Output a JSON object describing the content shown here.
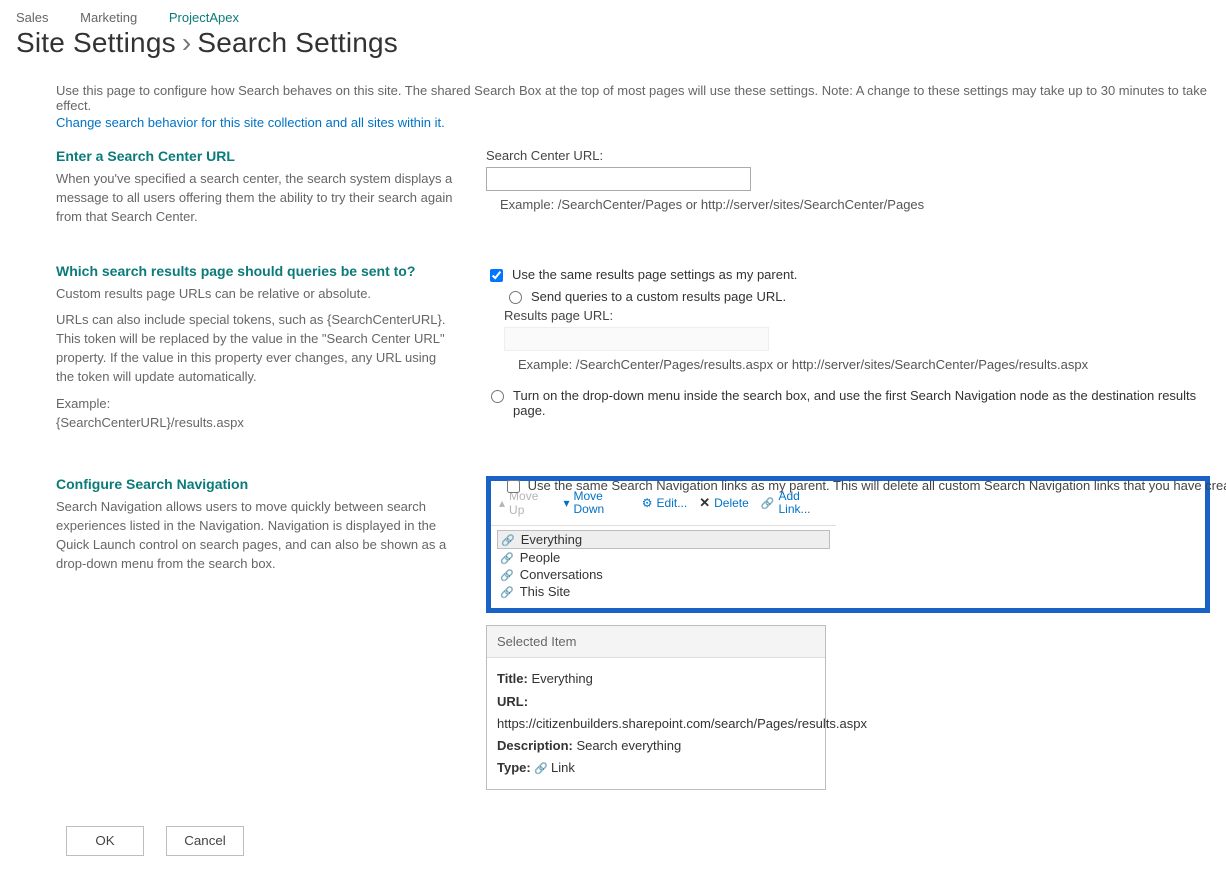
{
  "breadcrumb": {
    "a": "Sales",
    "b": "Marketing",
    "c": "ProjectApex"
  },
  "title": {
    "left": "Site Settings",
    "right": "Search Settings"
  },
  "intro": "Use this page to configure how Search behaves on this site. The shared Search Box at the top of most pages will use these settings. Note: A change to these settings may take up to 30 minutes to take effect.",
  "intro_link": "Change search behavior for this site collection and all sites within it.",
  "s1": {
    "title": "Enter a Search Center URL",
    "desc": "When you've specified a search center, the search system displays a message to all users offering them the ability to try their search again from that Search Center.",
    "label": "Search Center URL:",
    "example": "Example: /SearchCenter/Pages or http://server/sites/SearchCenter/Pages"
  },
  "s2": {
    "title": "Which search results page should queries be sent to?",
    "desc1": "Custom results page URLs can be relative or absolute.",
    "desc2": "URLs can also include special tokens, such as {SearchCenterURL}. This token will be replaced by the value in the \"Search Center URL\" property. If the value in this property ever changes, any URL using the token will update automatically.",
    "desc3": "Example:",
    "desc4": "{SearchCenterURL}/results.aspx",
    "opt1": "Use the same results page settings as my parent.",
    "opt2": "Send queries to a custom results page URL.",
    "label": "Results page URL:",
    "example": "Example: /SearchCenter/Pages/results.aspx or http://server/sites/SearchCenter/Pages/results.aspx",
    "opt3": "Turn on the drop-down menu inside the search box, and use the first Search Navigation node as the destination results page."
  },
  "s3": {
    "title": "Configure Search Navigation",
    "desc": "Search Navigation allows users to move quickly between search experiences listed in the Navigation. Navigation is displayed in the Quick Launch control on search pages, and can also be shown as a drop-down menu from the search box.",
    "parent": "Use the same Search Navigation links as my parent. This will delete all custom Search Navigation links that you have created for this site.",
    "toolbar": {
      "up": "Move Up",
      "down": "Move Down",
      "edit": "Edit...",
      "del": "Delete",
      "add": "Add Link..."
    },
    "items": [
      "Everything",
      "People",
      "Conversations",
      "This Site"
    ],
    "selhead": "Selected Item",
    "sel": {
      "title_l": "Title:",
      "title_v": "Everything",
      "url_l": "URL:",
      "url_v": "https://citizenbuilders.sharepoint.com/search/Pages/results.aspx",
      "desc_l": "Description:",
      "desc_v": "Search everything",
      "type_l": "Type:",
      "type_v": "Link"
    }
  },
  "btn": {
    "ok": "OK",
    "cancel": "Cancel"
  }
}
